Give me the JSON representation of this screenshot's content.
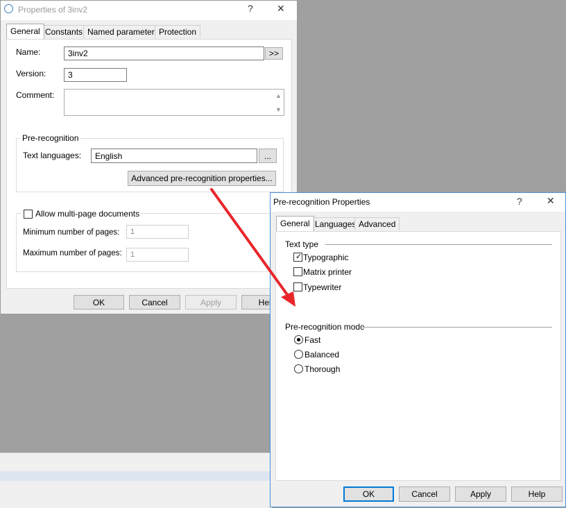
{
  "props_dialog": {
    "title": "Properties of 3inv2",
    "help_glyph": "?",
    "close_glyph": "✕",
    "tabs": [
      "General",
      "Constants",
      "Named parameters",
      "Protection"
    ],
    "name_label": "Name:",
    "name_value": "3inv2",
    "name_more": ">>",
    "version_label": "Version:",
    "version_value": "3",
    "comment_label": "Comment:",
    "comment_value": "",
    "prerec_group": "Pre-recognition",
    "text_languages_label": "Text languages:",
    "text_languages_value": "English",
    "text_languages_browse": "...",
    "advanced_button": "Advanced pre-recognition properties...",
    "multipage_label": "Allow multi-page documents",
    "multipage_checked": false,
    "min_pages_label": "Minimum number of pages:",
    "min_pages_value": "1",
    "max_pages_label": "Maximum number of pages:",
    "max_pages_value": "1",
    "ok": "OK",
    "cancel": "Cancel",
    "apply": "Apply",
    "help": "Help"
  },
  "prerec_dialog": {
    "title": "Pre-recognition Properties",
    "help_glyph": "?",
    "close_glyph": "✕",
    "tabs": [
      "General",
      "Languages",
      "Advanced"
    ],
    "text_type_label": "Text type",
    "text_types": [
      {
        "label": "Typographic",
        "checked": true
      },
      {
        "label": "Matrix printer",
        "checked": false
      },
      {
        "label": "Typewriter",
        "checked": false
      }
    ],
    "mode_label": "Pre-recognition mode",
    "modes": [
      {
        "label": "Fast",
        "selected": true
      },
      {
        "label": "Balanced",
        "selected": false
      },
      {
        "label": "Thorough",
        "selected": false
      }
    ],
    "ok": "OK",
    "cancel": "Cancel",
    "apply": "Apply",
    "help": "Help"
  },
  "colors": {
    "accent": "#0078d7",
    "arrow": "#e8262b",
    "background": "#a0a0a0"
  }
}
